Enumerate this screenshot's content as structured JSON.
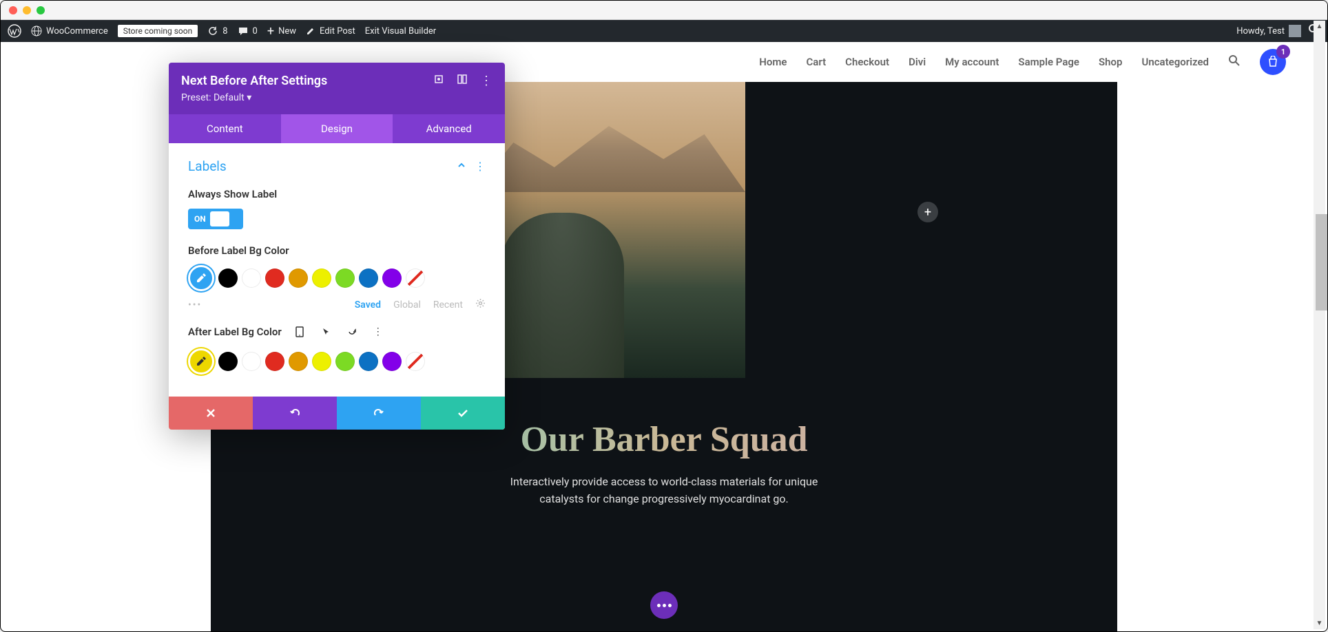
{
  "wp_bar": {
    "woocommerce": "WooCommerce",
    "store_badge": "Store coming soon",
    "update_count": "8",
    "comment_count": "0",
    "new": "New",
    "edit_post": "Edit Post",
    "exit_builder": "Exit Visual Builder",
    "howdy": "Howdy, Test"
  },
  "nav": {
    "items": [
      "Home",
      "Cart",
      "Checkout",
      "Divi",
      "My account",
      "Sample Page",
      "Shop",
      "Uncategorized"
    ],
    "cart_count": "1"
  },
  "page": {
    "heading": "Our Barber Squad",
    "sub1": "Interactively provide access to world-class materials for unique",
    "sub2": "catalysts for change progressively myocardinat go."
  },
  "panel": {
    "title": "Next Before After Settings",
    "preset": "Preset: Default",
    "tabs": {
      "content": "Content",
      "design": "Design",
      "advanced": "Advanced"
    },
    "section": "Labels",
    "always_show": "Always Show Label",
    "toggle_state": "ON",
    "before_color": "Before Label Bg Color",
    "after_color": "After Label Bg Color",
    "palette_tabs": {
      "saved": "Saved",
      "global": "Global",
      "recent": "Recent"
    },
    "swatch_colors": [
      "#000000",
      "#ffffff",
      "#e02b20",
      "#e09900",
      "#edf000",
      "#7cda24",
      "#0c71c3",
      "#8300e9"
    ]
  }
}
